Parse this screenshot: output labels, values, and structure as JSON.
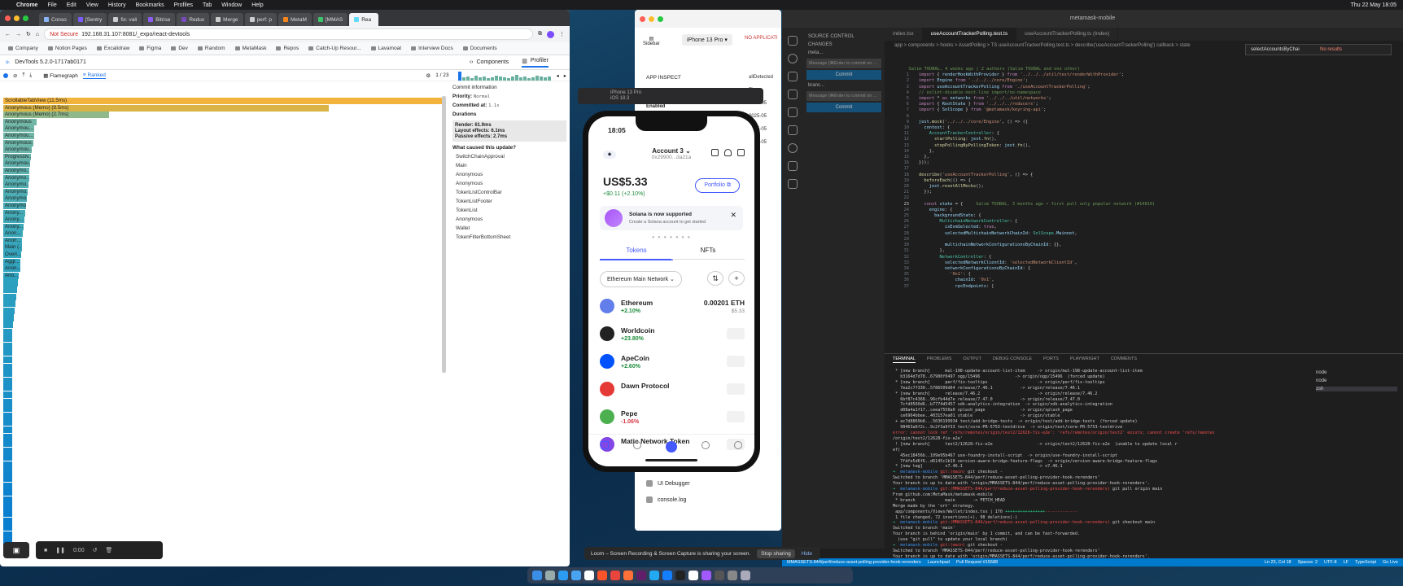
{
  "menubar": {
    "app": "Chrome",
    "items": [
      "File",
      "Edit",
      "View",
      "History",
      "Bookmarks",
      "Profiles",
      "Tab",
      "Window",
      "Help"
    ],
    "clock": "Thu 22 May 18:05"
  },
  "chrome": {
    "tabs": [
      "Conso",
      "[Sentry",
      "fix: vali",
      "Bitrise",
      "Redux",
      "Merge",
      "perf: p",
      "MetaM",
      "[MMAS",
      "Rea"
    ],
    "url_warning": "Not Secure",
    "url": "192.168.31.107:8081/_expo/react-devtools",
    "bookmarks": [
      "Company",
      "Notion Pages",
      "Excalidraw",
      "Figma",
      "Dev",
      "Random",
      "MetaMask",
      "Repos",
      "Catch-Up Resour...",
      "Lavamoat",
      "Interview Docs",
      "Documents"
    ],
    "devtools_version": "DevTools 5.2.0-1717ab0171",
    "tab_components": "Components",
    "tab_profiler": "Profiler",
    "toolbar": {
      "flamegraph": "Flamegraph",
      "ranked": "Ranked",
      "pager": "1 / 23"
    },
    "bars": [
      {
        "label": "ScrollableTabView (11.5ms)",
        "width": 100,
        "color": "#f2b33d"
      },
      {
        "label": "Anonymous (Memo) (8.5ms)",
        "width": 74,
        "color": "#d9b445"
      },
      {
        "label": "Anonymous (Memo) (2.7ms)",
        "width": 24,
        "color": "#8fb98a"
      },
      {
        "label": "Anonymous",
        "width": 7.5,
        "color": "#72b7a6"
      },
      {
        "label": "Anonymou...",
        "width": 7,
        "color": "#6fb6a7"
      },
      {
        "label": "Anonymou...",
        "width": 7,
        "color": "#6fb6a7"
      },
      {
        "label": "Anonymous (Ma...",
        "width": 6.8,
        "color": "#6cb5a8"
      },
      {
        "label": "Anonymou...",
        "width": 6.5,
        "color": "#6ab3a9"
      },
      {
        "label": "Progressiv...",
        "width": 6.3,
        "color": "#68b2aa"
      },
      {
        "label": "Anonymou...",
        "width": 6.2,
        "color": "#5fb1ad"
      },
      {
        "label": "Anonymo...",
        "width": 6,
        "color": "#5bb0ae"
      },
      {
        "label": "Anonymo...",
        "width": 6,
        "color": "#56afb0"
      },
      {
        "label": "Anonymo...",
        "width": 5.8,
        "color": "#52aeb1"
      },
      {
        "label": "Anonymo...",
        "width": 5.6,
        "color": "#4eadb3"
      },
      {
        "label": "Anonymo...",
        "width": 5.4,
        "color": "#4aacb4"
      },
      {
        "label": "Anonymo...",
        "width": 5.2,
        "color": "#46abb5"
      },
      {
        "label": "Anony...",
        "width": 5,
        "color": "#43aab6"
      },
      {
        "label": "Anony...",
        "width": 4.8,
        "color": "#40a9b7"
      },
      {
        "label": "Anony...",
        "width": 4.6,
        "color": "#3da8b8"
      },
      {
        "label": "Anon...",
        "width": 4.4,
        "color": "#3aa7b9"
      },
      {
        "label": "Anon...",
        "width": 4.3,
        "color": "#38a6ba"
      },
      {
        "label": "Main (...",
        "width": 4.2,
        "color": "#36a5bb"
      },
      {
        "label": "Overl...",
        "width": 4,
        "color": "#34a4bc"
      },
      {
        "label": "Aggr...",
        "width": 3.9,
        "color": "#32a3bc"
      },
      {
        "label": "Anon...",
        "width": 3.8,
        "color": "#30a2bd"
      },
      {
        "label": "Ano...",
        "width": 3.6,
        "color": "#2ea1be"
      },
      {
        "label": "",
        "width": 3.4,
        "color": "#2ca0bf"
      },
      {
        "label": "",
        "width": 3.2,
        "color": "#2a9fc0"
      },
      {
        "label": "",
        "width": 3,
        "color": "#299ec0"
      },
      {
        "label": "",
        "width": 2.8,
        "color": "#289dc1"
      },
      {
        "label": "",
        "width": 2.6,
        "color": "#279cc1"
      },
      {
        "label": "",
        "width": 2.4,
        "color": "#269bc2"
      },
      {
        "label": "",
        "width": 2.2,
        "color": "#259ac2"
      },
      {
        "label": "",
        "width": 2,
        "color": "#2499c3"
      },
      {
        "label": "",
        "width": 2,
        "color": "#2398c3"
      },
      {
        "label": "",
        "width": 2,
        "color": "#2297c4"
      },
      {
        "label": "",
        "width": 2,
        "color": "#2196c4"
      },
      {
        "label": "",
        "width": 2,
        "color": "#2095c5"
      },
      {
        "label": "",
        "width": 2,
        "color": "#1f94c5"
      },
      {
        "label": "",
        "width": 2,
        "color": "#1e93c6"
      },
      {
        "label": "",
        "width": 2,
        "color": "#1d92c6"
      },
      {
        "label": "",
        "width": 2,
        "color": "#1c91c7"
      },
      {
        "label": "",
        "width": 2,
        "color": "#1b90c7"
      },
      {
        "label": "",
        "width": 2,
        "color": "#1a8fc8"
      },
      {
        "label": "",
        "width": 2,
        "color": "#198ec8"
      },
      {
        "label": "",
        "width": 2,
        "color": "#188dc9"
      },
      {
        "label": "",
        "width": 2,
        "color": "#178cc9"
      },
      {
        "label": "",
        "width": 2,
        "color": "#168bca"
      },
      {
        "label": "",
        "width": 2,
        "color": "#158aca"
      },
      {
        "label": "",
        "width": 2,
        "color": "#1489cb"
      },
      {
        "label": "",
        "width": 2,
        "color": "#1388cb"
      },
      {
        "label": "",
        "width": 2,
        "color": "#1287cc"
      },
      {
        "label": "",
        "width": 2,
        "color": "#1186cc"
      },
      {
        "label": "",
        "width": 2,
        "color": "#1085cd"
      },
      {
        "label": "",
        "width": 2,
        "color": "#0f84cd"
      },
      {
        "label": "",
        "width": 2,
        "color": "#0e83ce"
      },
      {
        "label": "",
        "width": 2,
        "color": "#0d82ce"
      },
      {
        "label": "",
        "width": 2,
        "color": "#0c81cf"
      },
      {
        "label": "",
        "width": 2,
        "color": "#0b80cf"
      },
      {
        "label": "",
        "width": 2,
        "color": "#0a7fd0"
      },
      {
        "label": "",
        "width": 2,
        "color": "#0a7fd0"
      },
      {
        "label": "",
        "width": 2,
        "color": "#0a7fd0"
      },
      {
        "label": "",
        "width": 2,
        "color": "#0a7fd0"
      },
      {
        "label": "",
        "width": 2,
        "color": "#0a7fd0"
      }
    ],
    "commit": {
      "title": "Commit information",
      "priority_label": "Priority:",
      "priority": "Normal",
      "committed_label": "Committed at:",
      "committed": "1.1s",
      "durations": "Durations",
      "render": "Render: 61.9ms",
      "layout": "Layout effects: 6.1ms",
      "passive": "Passive effects: 2.7ms",
      "cause_title": "What caused this update?",
      "causes": [
        "SwitchChainApproval",
        "Main",
        "Anonymous",
        "Anonymous",
        "TokenListControlBar",
        "TokenListFooter",
        "TokenList",
        "Anonymous",
        "Wallet",
        "TokenFilterBottomSheet"
      ]
    },
    "loom_time": "0:00"
  },
  "inspect": {
    "sidebar": "Sidebar",
    "device": "iPhone 13 Pro",
    "na": "NO APPLICATI",
    "title": "APP INSPECT",
    "detected": "allDetected",
    "col": "Time",
    "rows": [
      "2025-05",
      "2025-05",
      "2025-05",
      "2025-05"
    ],
    "enabled": "Enabled",
    "ui_debugger": "UI Debugger",
    "console": "console.log"
  },
  "sim": {
    "title": "iPhone 13 Pro",
    "sub": "iOS 18.3"
  },
  "phone": {
    "time": "18:05",
    "account": "Account 3",
    "address": "0x29900...da21a",
    "balance": "US$5.33",
    "delta": "+$0.11 (+2.10%)",
    "portfolio": "Portfolio",
    "banner_title": "Solana is now supported",
    "banner_sub": "Create a Solana account to get started",
    "pager": "● ● ● ● ● ● ●",
    "tab_tokens": "Tokens",
    "tab_nfts": "NFTs",
    "network": "Ethereum Main Network",
    "tokens": [
      {
        "name": "Ethereum",
        "change": "+2.10%",
        "value": "0.00201 ETH",
        "fiat": "$5.33",
        "color": "#627eea",
        "neg": false
      },
      {
        "name": "Worldcoin",
        "change": "+23.80%",
        "value": "",
        "fiat": "",
        "color": "#222",
        "neg": false
      },
      {
        "name": "ApeCoin",
        "change": "+2.60%",
        "value": "",
        "fiat": "",
        "color": "#0052ff",
        "neg": false
      },
      {
        "name": "Dawn Protocol",
        "change": "",
        "value": "",
        "fiat": "",
        "color": "#e53935",
        "neg": false
      },
      {
        "name": "Pepe",
        "change": "-1.06%",
        "value": "",
        "fiat": "",
        "color": "#4caf50",
        "neg": true
      },
      {
        "name": "Matic Network Token",
        "change": "",
        "value": "",
        "fiat": "",
        "color": "#8247e5",
        "neg": false
      }
    ]
  },
  "vscode": {
    "title": "metamask-mobile",
    "sc": "SOURCE CONTROL",
    "changes": "CHANGES",
    "repo1": "meta...",
    "repo2": "branc...",
    "msg": "Message (⌘Enter to commit on ...",
    "commit": "Commit",
    "tabs": [
      "index.tsx",
      "useAccountTrackerPolling.test.ts",
      "useAccountTrackerPolling.ts (Index)"
    ],
    "crumbs": "app > components > hooks > AssetPolling > TS useAccountTrackerPolling.test.ts > describe('useAccountTrackerPolling') callback > state",
    "find": "selectAccountsByChai",
    "noresults": "No results",
    "terminal_tabs": [
      "TERMINAL",
      "PROBLEMS",
      "OUTPUT",
      "DEBUG CONSOLE",
      "PORTS",
      "PLAYWRIGHT",
      "COMMENTS"
    ],
    "shells": [
      "node",
      "node",
      "zsh"
    ],
    "status": [
      "MMASSETS-844/perf/reduce-asset-polling-provider-hook-rerenders",
      "Launchpad",
      "Pull Request #15588",
      "Ln 23, Col 18",
      "Spaces: 2",
      "UTF-8",
      "LF",
      "TypeScript",
      "Go Live"
    ]
  },
  "share": {
    "text": "Loom – Screen Recording & Screen Capture is sharing your screen.",
    "stop": "Stop sharing",
    "hide": "Hide"
  }
}
